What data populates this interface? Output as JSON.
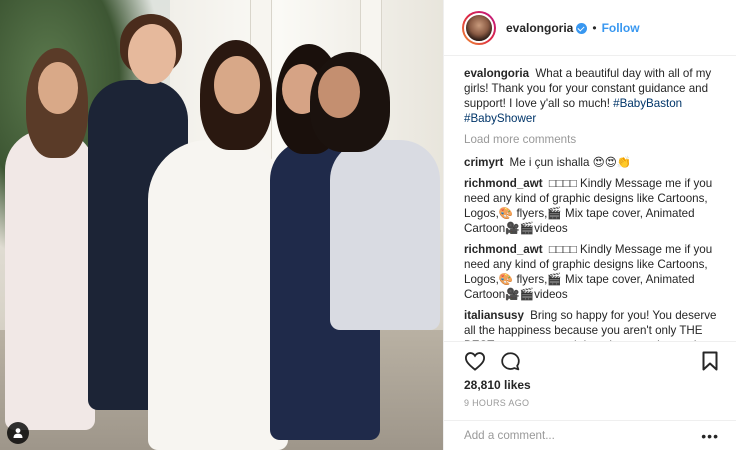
{
  "post": {
    "account": {
      "username": "evalongoria",
      "verified": true,
      "follow_label": "Follow",
      "separator": "•"
    },
    "photo": {
      "user_tag_icon": "person-icon"
    },
    "caption": {
      "username": "evalongoria",
      "text": "What a beautiful day with all of my girls! Thank you for your constant guidance and support! I love y'all so much!",
      "hashtags": "#BabyBaston #BabyShower"
    },
    "load_more_label": "Load more comments",
    "comments": [
      {
        "user": "crimyrt",
        "text": "Me i çun ishalla 😍😍👏"
      },
      {
        "user": "richmond_awt",
        "text": "□□□□ Kindly Message me if you need any kind of graphic designs like Cartoons,  Logos,🎨 flyers,🎬 Mix tape cover,  Animated Cartoon🎥🎬videos"
      },
      {
        "user": "richmond_awt",
        "text": "□□□□ Kindly Message me if you need any kind of graphic designs like Cartoons,  Logos,🎨 flyers,🎬 Mix tape cover,  Animated Cartoon🎥🎬videos"
      },
      {
        "user": "italiansusy",
        "text": "Bring so happy for you! You deserve all the happiness because you aren't only THE BEST actress on earth but also a tue-hearted person! I love seeing you being were you deserve to be ❤"
      }
    ],
    "actions": {
      "like_icon": "heart-icon",
      "comment_icon": "comment-icon",
      "save_icon": "bookmark-icon"
    },
    "likes": "28,810 likes",
    "timestamp": "9 HOURS AGO",
    "add_comment": {
      "placeholder": "Add a comment...",
      "more_icon": "more-options-icon",
      "more_label": "•••"
    }
  },
  "colors": {
    "accent": "#3897f0",
    "hashtag": "#003569",
    "muted": "#999999",
    "text": "#262626"
  }
}
